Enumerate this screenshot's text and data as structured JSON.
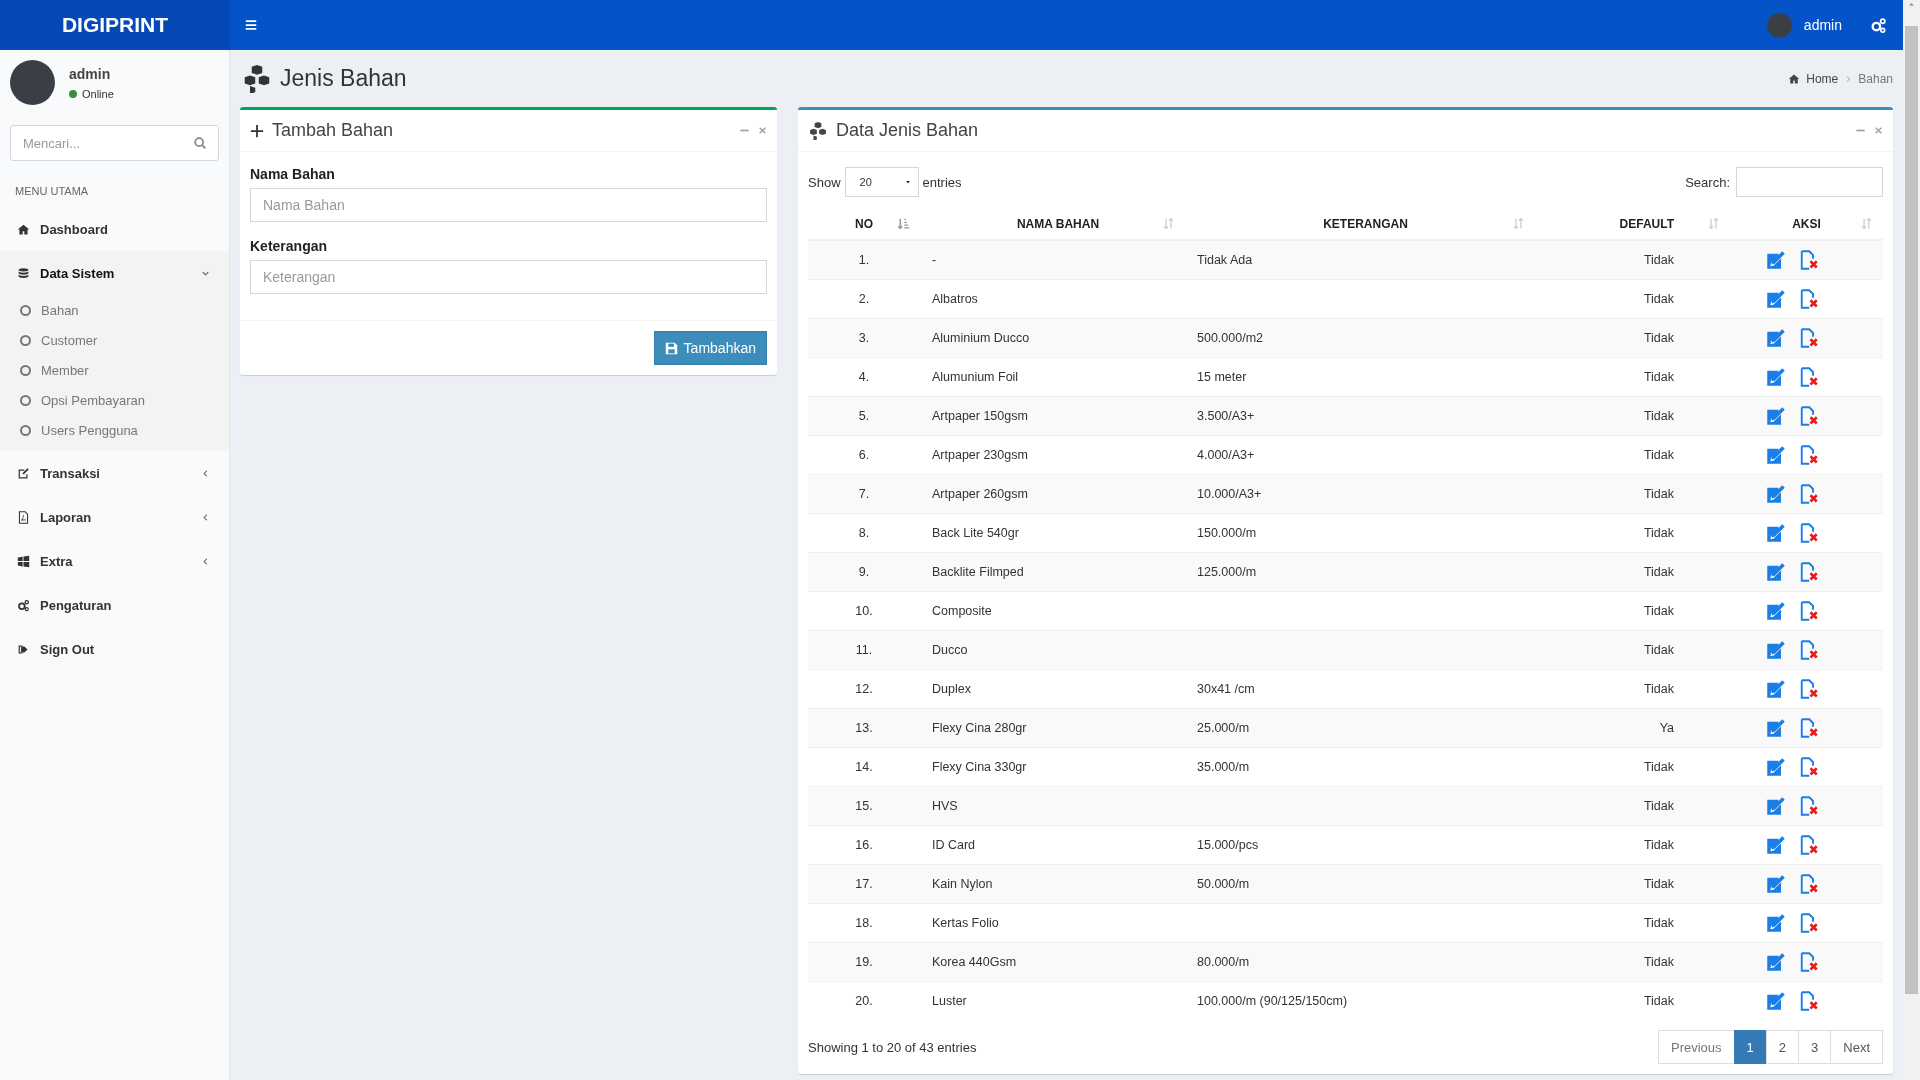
{
  "header": {
    "brand": "DIGIPRINT",
    "user": "admin"
  },
  "sidebar": {
    "user": {
      "name": "admin",
      "status": "Online"
    },
    "search": {
      "placeholder": "Mencari..."
    },
    "section": "MENU UTAMA",
    "items": [
      {
        "label": "Dashboard"
      },
      {
        "label": "Data Sistem",
        "expanded": true,
        "children": [
          {
            "label": "Bahan"
          },
          {
            "label": "Customer"
          },
          {
            "label": "Member"
          },
          {
            "label": "Opsi Pembayaran"
          },
          {
            "label": "Users Pengguna"
          }
        ]
      },
      {
        "label": "Transaksi",
        "expanded": false
      },
      {
        "label": "Laporan",
        "expanded": false
      },
      {
        "label": "Extra",
        "expanded": false
      },
      {
        "label": "Pengaturan"
      },
      {
        "label": "Sign Out"
      }
    ]
  },
  "page": {
    "title": "Jenis Bahan",
    "breadcrumb": [
      "Home",
      "Bahan"
    ]
  },
  "form_panel": {
    "title": "Tambah Bahan",
    "fields": [
      {
        "label": "Nama Bahan",
        "placeholder": "Nama Bahan"
      },
      {
        "label": "Keterangan",
        "placeholder": "Keterangan"
      }
    ],
    "button": "Tambahkan"
  },
  "table_panel": {
    "title": "Data Jenis Bahan",
    "show_label": "Show",
    "page_size": "20",
    "entries_label": "entries",
    "search_label": "Search:",
    "columns": [
      {
        "label": "NO",
        "sorted": true
      },
      {
        "label": "NAMA BAHAN",
        "sorted": false
      },
      {
        "label": "KETERANGAN",
        "sorted": false
      },
      {
        "label": "DEFAULT",
        "sorted": false
      },
      {
        "label": "AKSI",
        "sorted": false
      }
    ],
    "rows": [
      {
        "no": "1.",
        "nama": "-",
        "keterangan": "Tidak Ada",
        "default": "Tidak"
      },
      {
        "no": "2.",
        "nama": "Albatros",
        "default": "Tidak"
      },
      {
        "no": "3.",
        "nama": "Aluminium Ducco",
        "keterangan": "500.000/m2",
        "default": "Tidak"
      },
      {
        "no": "4.",
        "nama": "Alumunium Foil",
        "keterangan": "15 meter",
        "default": "Tidak"
      },
      {
        "no": "5.",
        "nama": "Artpaper 150gsm",
        "keterangan": "3.500/A3+",
        "default": "Tidak"
      },
      {
        "no": "6.",
        "nama": "Artpaper 230gsm",
        "keterangan": "4.000/A3+",
        "default": "Tidak"
      },
      {
        "no": "7.",
        "nama": "Artpaper 260gsm",
        "keterangan": "10.000/A3+",
        "default": "Tidak"
      },
      {
        "no": "8.",
        "nama": "Back Lite 540gr",
        "keterangan": "150.000/m",
        "default": "Tidak"
      },
      {
        "no": "9.",
        "nama": "Backlite Filmped",
        "keterangan": "125.000/m",
        "default": "Tidak"
      },
      {
        "no": "10.",
        "nama": "Composite",
        "default": "Tidak"
      },
      {
        "no": "11.",
        "nama": "Ducco",
        "default": "Tidak"
      },
      {
        "no": "12.",
        "nama": "Duplex",
        "keterangan": "30x41 /cm",
        "default": "Tidak"
      },
      {
        "no": "13.",
        "nama": "Flexy Cina 280gr",
        "keterangan": "25.000/m",
        "default": "Ya"
      },
      {
        "no": "14.",
        "nama": "Flexy Cina 330gr",
        "keterangan": "35.000/m",
        "default": "Tidak"
      },
      {
        "no": "15.",
        "nama": "HVS",
        "default": "Tidak"
      },
      {
        "no": "16.",
        "nama": "ID Card",
        "keterangan": "15.000/pcs",
        "default": "Tidak"
      },
      {
        "no": "17.",
        "nama": "Kain Nylon",
        "keterangan": "50.000/m",
        "default": "Tidak"
      },
      {
        "no": "18.",
        "nama": "Kertas Folio",
        "default": "Tidak"
      },
      {
        "no": "19.",
        "nama": "Korea 440Gsm",
        "keterangan": "80.000/m",
        "default": "Tidak"
      },
      {
        "no": "20.",
        "nama": "Luster",
        "keterangan": "100.000/m (90/125/150cm)",
        "default": "Tidak"
      }
    ],
    "info": "Showing 1 to 20 of 43 entries",
    "pagination": {
      "previous": "Previous",
      "next": "Next",
      "pages": [
        {
          "label": "1",
          "selected": true
        },
        {
          "label": "2",
          "selected": false
        },
        {
          "label": "3",
          "selected": false
        }
      ]
    }
  }
}
